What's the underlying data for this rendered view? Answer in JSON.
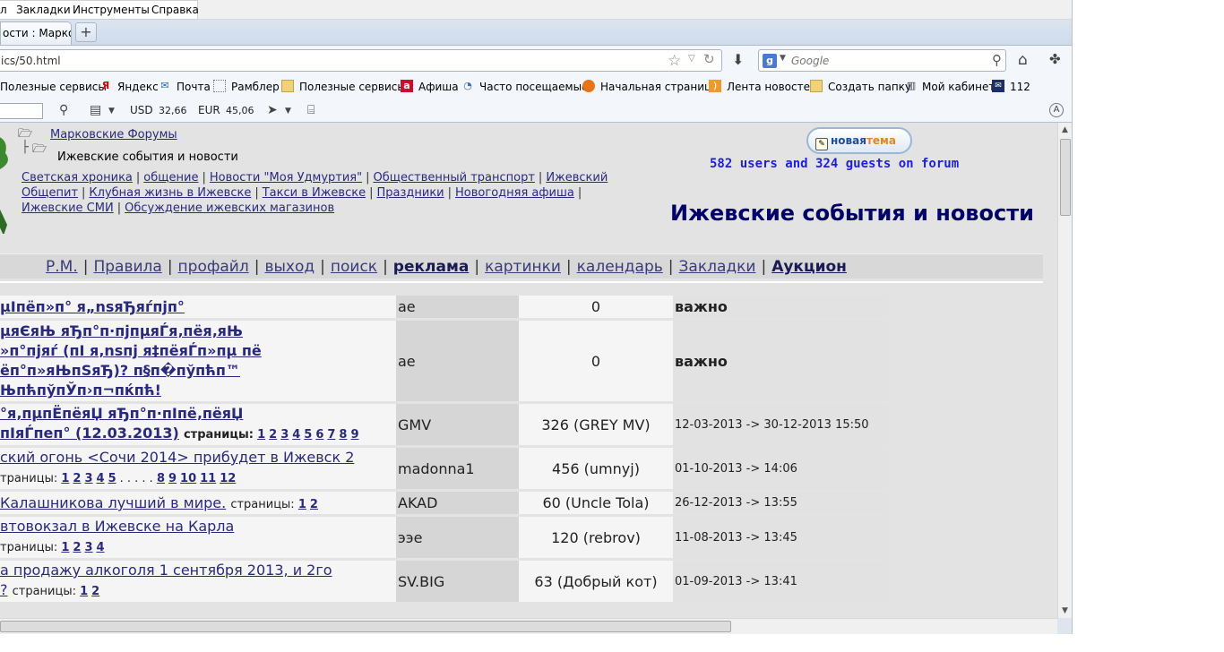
{
  "menubar": {
    "items": [
      "л",
      "Закладки",
      "Инструменты",
      "Справка"
    ]
  },
  "tab": {
    "title": "ости : Марко..."
  },
  "newtab": {
    "label": "+"
  },
  "navbar": {
    "url": "ics/50.html",
    "search_placeholder": "Google",
    "search_engine_letter": "g"
  },
  "bookmarks": [
    "Полезные сервисы",
    "Яндекс",
    "Почта",
    "Рамблер",
    "Полезные сервисы",
    "Афиша",
    "Часто посещаемые",
    "Начальная страница",
    "Лента новостей",
    "Создать папку",
    "Мой кабинет",
    "112"
  ],
  "addonbar": {
    "usd_label": "USD",
    "usd_value": "32,66",
    "eur_label": "EUR",
    "eur_value": "45,06"
  },
  "forum": {
    "breadcrumb_root": "Марковские Форумы",
    "breadcrumb_current": "Ижевские события и новости",
    "categories": [
      "Светская хроника",
      "общение",
      "Новости \"Моя Удмуртия\"",
      "Общественный транспорт",
      "Ижевский Общепит",
      "Клубная жизнь в Ижевске",
      "Такси в Ижевске",
      "Праздники",
      "Новогодняя афиша",
      "Ижевские СМИ",
      "Обсуждение ижевских магазинов"
    ],
    "new_topic": {
      "part1": "новая",
      "part2": "тема"
    },
    "online": "582 users and 324 guests on forum",
    "title": "Ижевские события и новости",
    "nav": [
      "Р.М.",
      "Правила",
      "профайл",
      "выход",
      "поиск",
      "реклама",
      "картинки",
      "календарь",
      "Закладки",
      "Аукцион"
    ],
    "pages_label": "страницы:",
    "topics": [
      {
        "title": "µІпёп»п° я„nsяЂяѓпјп°",
        "author": "ae",
        "count": "0",
        "date": "важно"
      },
      {
        "title_lines": [
          "µяЄяЊ яЂп°п·пјпµяЃя‚пёя‚яЊ",
          "»п°пјяѓ (пІ я‚nsпј я‡пёяЃп»пµ пё",
          "ёп°п»яЊпЅяЂ)? п§п�пўпћп™",
          "ЊпћпўпЎп›п¬пќпћ!"
        ],
        "author": "ae",
        "count": "0",
        "date": "важно"
      },
      {
        "title_lines": [
          "°я‚пµпЁпёяЏ яЂп°п·пІпё‚пёяЏ",
          "пІяЃпеп° (12.03.2013)"
        ],
        "pages": [
          "1",
          "2",
          "3",
          "4",
          "5",
          "6",
          "7",
          "8",
          "9"
        ],
        "author": "GMV",
        "count": "326 (GREY MV)",
        "date": "12-03-2013 -> 30-12-2013 15:50"
      },
      {
        "title": "ский огонь <Сочи 2014> прибудет в Ижевск 2",
        "pages_prefix": "траницы:",
        "pages": [
          "1",
          "2",
          "3",
          "4",
          "5",
          ". . . . .",
          "8",
          "9",
          "10",
          "11",
          "12"
        ],
        "author": "madonna1",
        "count": "456 (umnyj)",
        "date": "01-10-2013 -> 14:06"
      },
      {
        "title": "Калашникова лучший в мире.",
        "pages": [
          "1",
          "2"
        ],
        "author": "AKAD",
        "count": "60 (Uncle Tola)",
        "date": "26-12-2013 -> 13:55"
      },
      {
        "title": "втовокзал в Ижевске на Карла",
        "pages_prefix": "траницы:",
        "pages": [
          "1",
          "2",
          "3",
          "4"
        ],
        "author": "ээе",
        "count": "120 (rebrov)",
        "date": "11-08-2013 -> 13:45"
      },
      {
        "title": "а продажу алкоголя 1 сентября 2013, и 2го",
        "title_tail": "?",
        "pages": [
          "1",
          "2"
        ],
        "author": "SV.BIG",
        "count": "63 (Добрый кот)",
        "date": "01-09-2013 -> 13:41"
      }
    ]
  },
  "colors": {
    "link": "#2a2a7a",
    "online_text": "#1f1fd9",
    "title_text": "#000066",
    "page_bg": "#e3e3e3"
  }
}
